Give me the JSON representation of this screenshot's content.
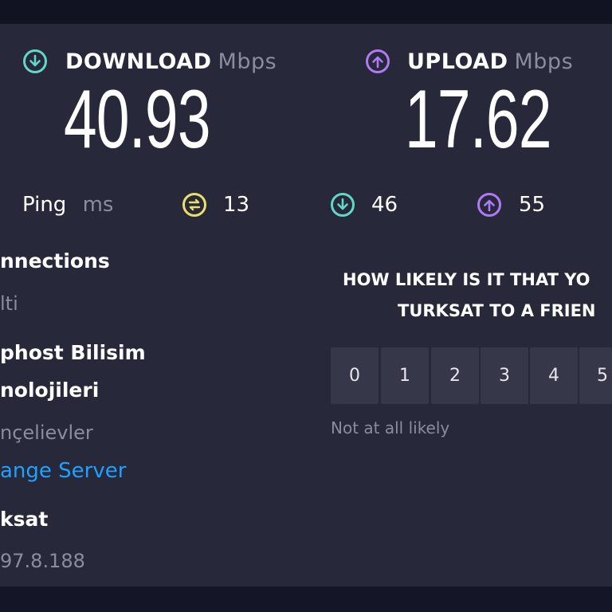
{
  "download": {
    "label": "DOWNLOAD",
    "unit": "Mbps",
    "value": "40.93",
    "icon": "download-circle-icon",
    "color": "#62d6c8"
  },
  "upload": {
    "label": "UPLOAD",
    "unit": "Mbps",
    "value": "17.62",
    "icon": "upload-circle-icon",
    "color": "#b07af5"
  },
  "ping": {
    "label": "Ping",
    "unit": "ms",
    "idle": "13",
    "download": "46",
    "upload": "55",
    "idle_color": "#e9df6a"
  },
  "connections": {
    "title": "nnections",
    "mode": "lti"
  },
  "server": {
    "name_line1": "phost Bilisim",
    "name_line2": "nolojileri",
    "location": "nçelievler",
    "change_label": "ange Server"
  },
  "provider": {
    "name": "ksat",
    "ip": "97.8.188"
  },
  "survey": {
    "question_line1": "HOW LIKELY IS IT THAT YO",
    "question_line2": "TURKSAT TO A FRIEN",
    "scores": [
      "0",
      "1",
      "2",
      "3",
      "4",
      "5"
    ],
    "low_label": "Not at all likely"
  }
}
